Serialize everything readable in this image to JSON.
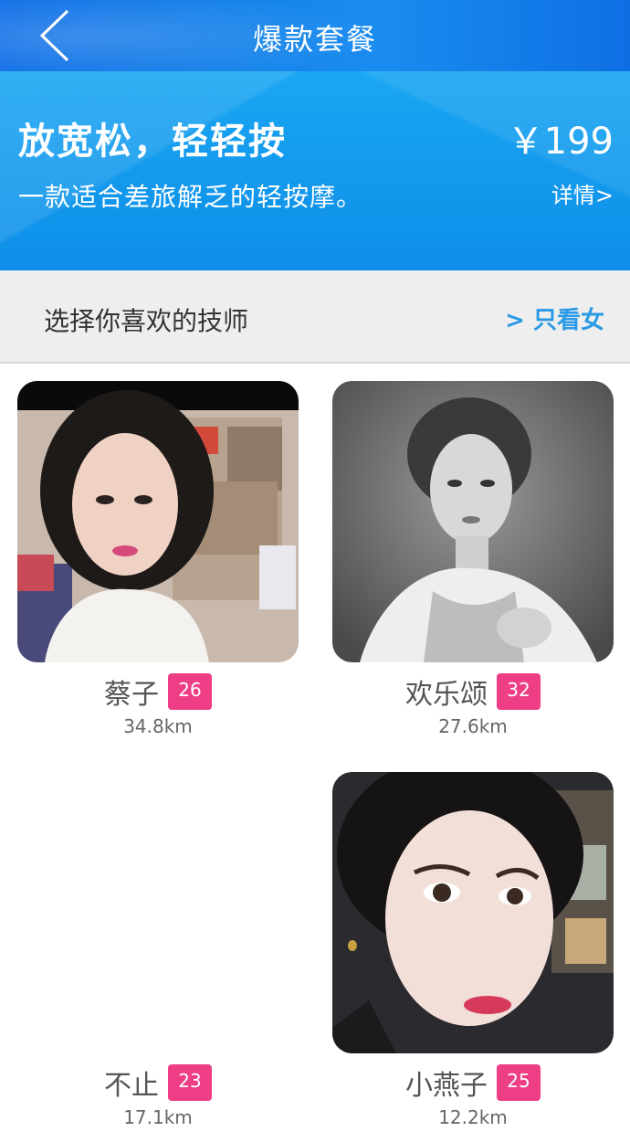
{
  "header": {
    "title": "爆款套餐"
  },
  "package": {
    "name": "放宽松，轻轻按",
    "price": "￥199",
    "description": "一款适合差旅解乏的轻按摩。",
    "detail_link": "详情>"
  },
  "section": {
    "title": "选择你喜欢的技师",
    "filter_label": "> 只看女"
  },
  "technicians": [
    {
      "name": "蔡子",
      "age": "26",
      "distance": "34.8km"
    },
    {
      "name": "欢乐颂",
      "age": "32",
      "distance": "27.6km"
    },
    {
      "name": "不止",
      "age": "23",
      "distance": "17.1km"
    },
    {
      "name": "小燕子",
      "age": "25",
      "distance": "12.2km"
    }
  ],
  "colors": {
    "header_blue": "#1583ea",
    "banner_blue": "#1ba6f2",
    "age_badge": "#ee3f86",
    "filter_link": "#2a9ae6"
  }
}
